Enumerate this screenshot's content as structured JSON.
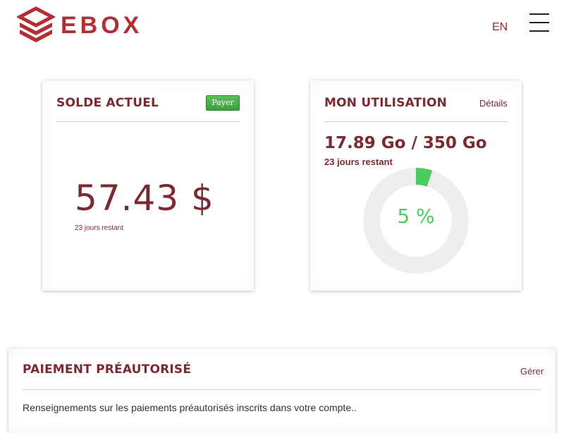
{
  "brand": {
    "name": "EBOX",
    "color": "#b32d33"
  },
  "header": {
    "language": "EN",
    "menu_icon": "hamburger-menu-icon"
  },
  "balance": {
    "title": "SOLDE ACTUEL",
    "pay_label": "Payer",
    "pay_color": "#4caf50",
    "amount": "57.43 $",
    "days_left": "23 jours restant"
  },
  "usage": {
    "title": "MON UTILISATION",
    "details_label": "Détails",
    "amount": "17.89 Go / 350 Go",
    "days_left": "23 jours restant",
    "percent_label": "5 %",
    "percent_value": 5,
    "used_color": "#4ccc5f",
    "track_color": "#eeeeee"
  },
  "autopay": {
    "title": "PAIEMENT PRÉAUTORISÉ",
    "manage_label": "Gérer",
    "description": "Renseignements sur les paiements préautorisés inscrits dans votre compte.."
  },
  "colors": {
    "text_primary": "#7a2a30"
  }
}
